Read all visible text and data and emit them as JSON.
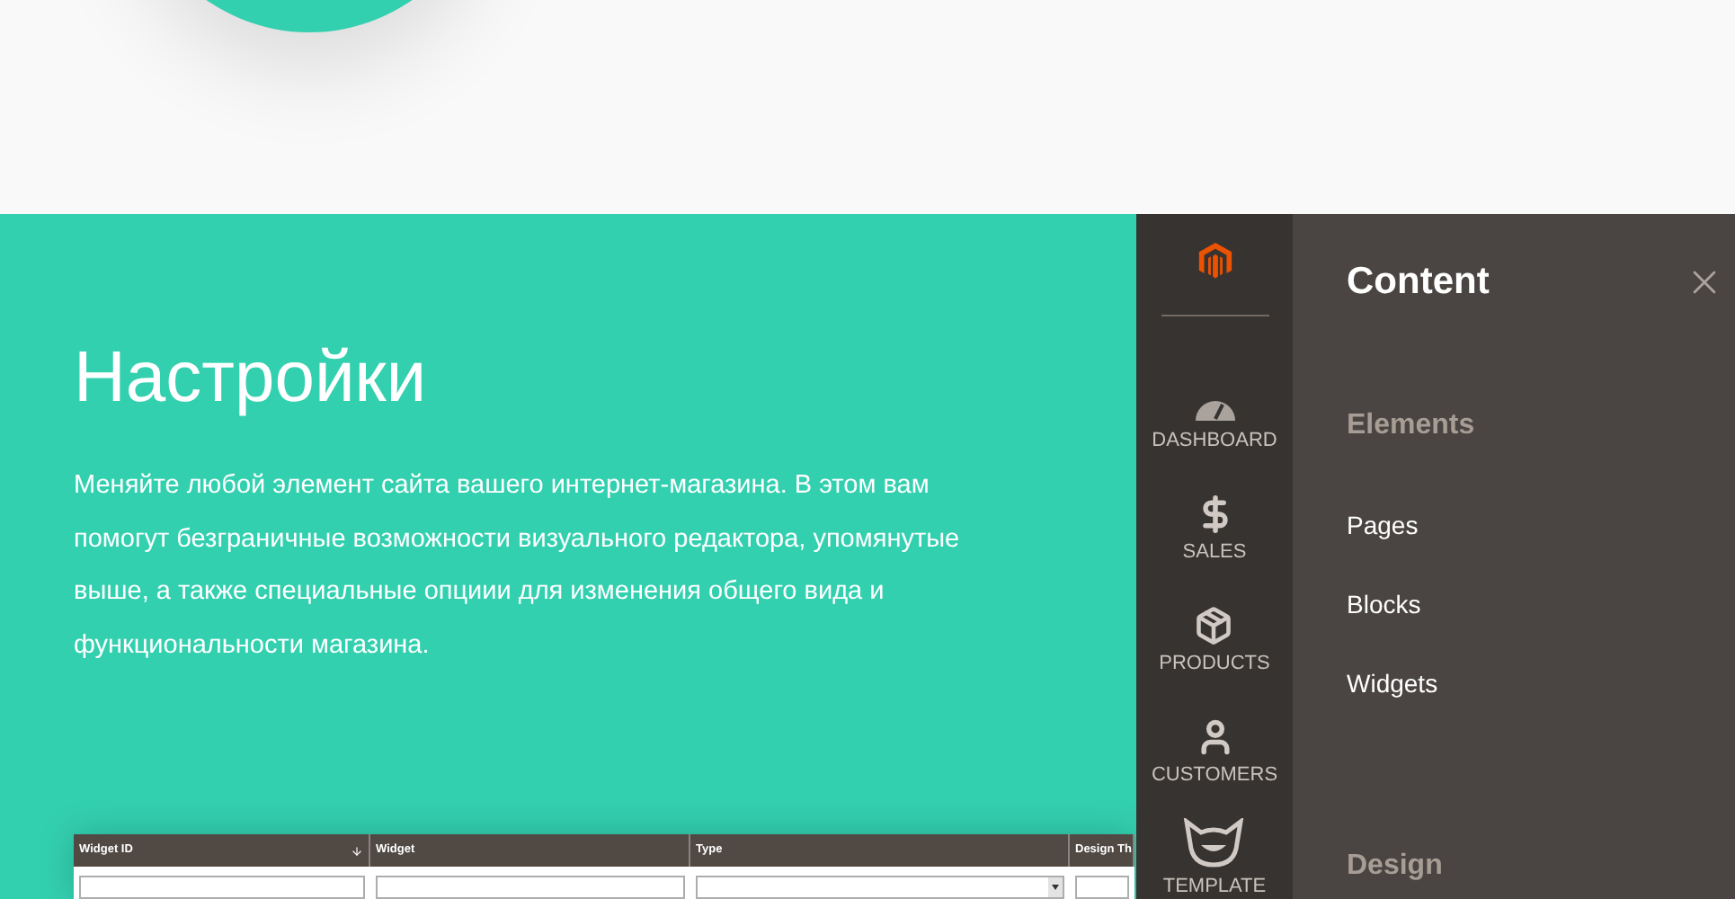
{
  "feature": {
    "title": "Настройки",
    "description": "Меняйте любой элемент сайта вашего интернет-магазина. В этом вам помогут безграничные возможности визуального редактора, упомянутые выше, а также специальные опциии для изменения общего вида и функциональности магазина."
  },
  "admin_sidebar": {
    "items": [
      {
        "kind": "dashboard",
        "label": "DASHBOARD"
      },
      {
        "kind": "sales",
        "label": "SALES"
      },
      {
        "kind": "products",
        "label": "PRODUCTS"
      },
      {
        "kind": "customers",
        "label": "CUSTOMERS"
      },
      {
        "kind": "template",
        "label": "TEMPLATE"
      }
    ]
  },
  "content_menu": {
    "title": "Content",
    "groups": [
      {
        "title": "Elements",
        "items": [
          "Pages",
          "Blocks",
          "Widgets"
        ]
      },
      {
        "title": "Design"
      }
    ]
  },
  "widgets_table": {
    "columns": [
      {
        "label": "Widget ID",
        "sorted": true,
        "kind": "text"
      },
      {
        "label": "Widget",
        "sorted": false,
        "kind": "text"
      },
      {
        "label": "Type",
        "sorted": false,
        "kind": "select"
      },
      {
        "label": "Design Th",
        "sorted": false,
        "kind": "text"
      }
    ]
  }
}
